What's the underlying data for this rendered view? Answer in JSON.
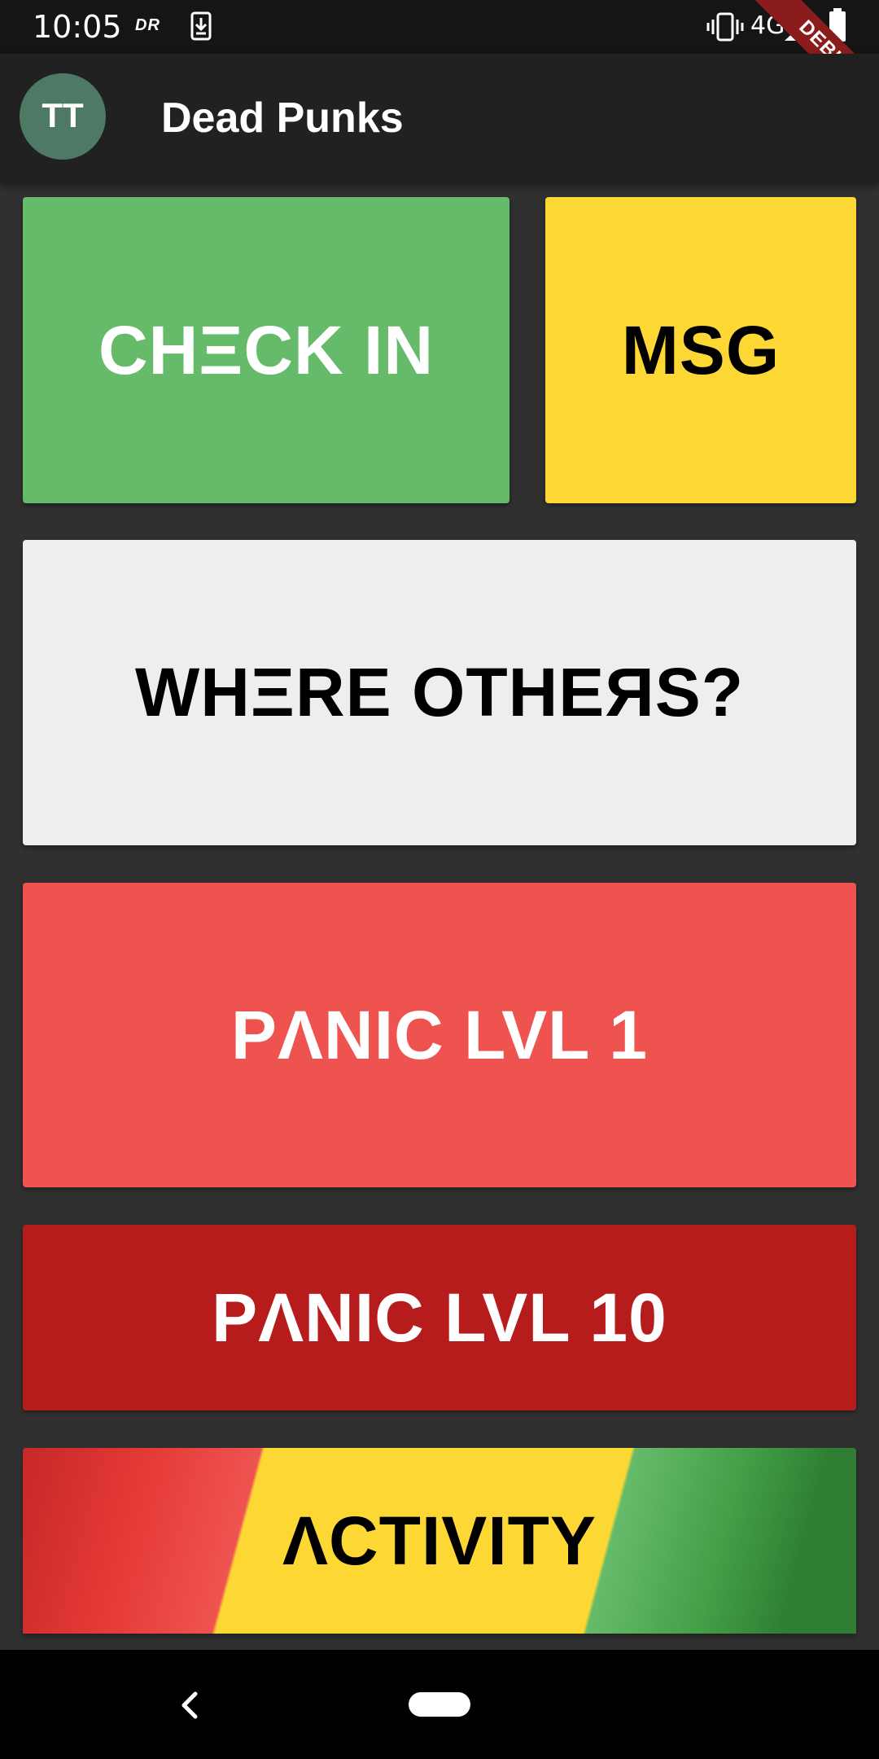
{
  "status_bar": {
    "time": "10:05",
    "dr_label": "DR",
    "network": "4G",
    "icons": [
      "download-icon",
      "vibrate-icon",
      "signal-icon",
      "battery-icon"
    ]
  },
  "debug_banner": {
    "label": "DEBUG"
  },
  "app_bar": {
    "avatar_initials": "TT",
    "avatar_color": "#4e7964",
    "title": "Dead Punks"
  },
  "tiles": {
    "check_in": {
      "label": "CHΞCK IN",
      "color": "#66bb6a"
    },
    "msg": {
      "label": "MSG",
      "color": "#fdd835"
    },
    "where_others": {
      "label": "WHΞRE OTHEЯS?",
      "color": "#eeeeee"
    },
    "panic_lvl_1": {
      "label": "PΛNIC LVL 1",
      "color": "#ef5350"
    },
    "panic_lvl_10": {
      "label": "PΛNIC LVL 10",
      "color": "#b71c1c"
    },
    "activity": {
      "label": "ΛCTIVITY",
      "colors": [
        "#e53935",
        "#fdd835",
        "#43a047"
      ]
    }
  },
  "nav_bar": {
    "icons": [
      "back-icon",
      "home-pill-icon"
    ]
  }
}
